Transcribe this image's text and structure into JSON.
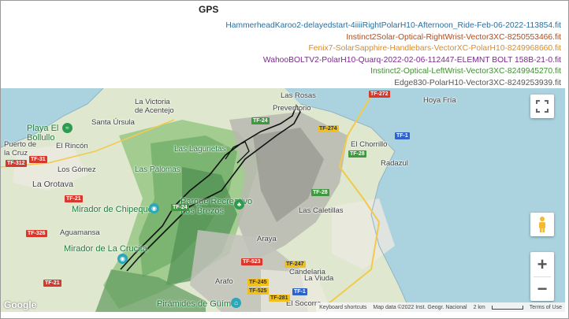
{
  "title": "GPS",
  "legend": [
    {
      "label": "HammerheadKaroo2-delayedstart-4iiiiRightPolarH10-Afternoon_Ride-Feb-06-2022-113854.fit",
      "color": "#2b6f9e"
    },
    {
      "label": "Instinct2Solar-Optical-RightWrist-Vector3XC-8250553466.fit",
      "color": "#b24a1d"
    },
    {
      "label": "Fenix7-SolarSapphire-Handlebars-VectorXC-PolarH10-8249968660.fit",
      "color": "#d98c2b"
    },
    {
      "label": "WahooBOLTV2-PolarH10-Quarq-2022-02-06-112447-ELEMNT BOLT 158B-21-0.fit",
      "color": "#7a2a8c"
    },
    {
      "label": "Instinct2-Optical-LeftWrist-Vector3XC-8249945270.fit",
      "color": "#3f8f2f"
    },
    {
      "label": "Edge830-PolarH10-Vector3XC-8249253939.fit",
      "color": "#555555"
    }
  ],
  "map": {
    "places": {
      "la_victoria": "La Victoria\nde Acentejo",
      "las_rosas": "Las Rosas",
      "prevantorio": "Preventorio",
      "hoya_fria": "Hoya Fría",
      "playa_bollullo": "Playa El\nBollullo",
      "santa_ursula": "Santa Úrsula",
      "puerto_cruz": "Puerto de\nla Cruz",
      "el_rincon": "El Rincón",
      "las_lagunetas": "Las Lagunetas",
      "el_chorrillo": "El Chorrillo",
      "radazul": "Radazul",
      "las_palomas": "Las Palomas",
      "los_gomez": "Los Gómez",
      "la_orotava": "La Orotava",
      "mirador_chipeque": "Mirador de Chipeque",
      "parque_recreativo": "Parque Recreativo\nLos Brezos",
      "las_caletillas": "Las Caletillas",
      "aguamansa": "Aguamansa",
      "araya": "Araya",
      "mirador_crucita": "Mirador de La Crucita",
      "candelaria": "Candelaria",
      "arafo": "Arafo",
      "la_viuda": "La Viuda",
      "el_socorro": "El Socorro",
      "piramides_guimar": "Pirámides de Güímar"
    },
    "roads": {
      "tf272": "TF-272",
      "tf24a": "TF-24",
      "tf274": "TF-274",
      "tf312": "TF-312",
      "tf31": "TF-31",
      "tf28a": "TF-28",
      "tf28b": "TF-28",
      "tf1a": "TF-1",
      "tf21a": "TF-21",
      "tf326": "TF-326",
      "tf21b": "TF-21",
      "tf24b": "TF-24",
      "tf523": "TF-523",
      "tf247": "TF-247",
      "tf245": "TF-245",
      "tf525": "TF-525",
      "tf281": "TF-281",
      "tf1b": "TF-1"
    },
    "attribution": {
      "shortcuts": "Keyboard shortcuts",
      "data": "Map data ©2022 Inst. Geogr. Nacional",
      "scale": "2 km",
      "terms": "Terms of Use"
    },
    "logo": "Google"
  }
}
